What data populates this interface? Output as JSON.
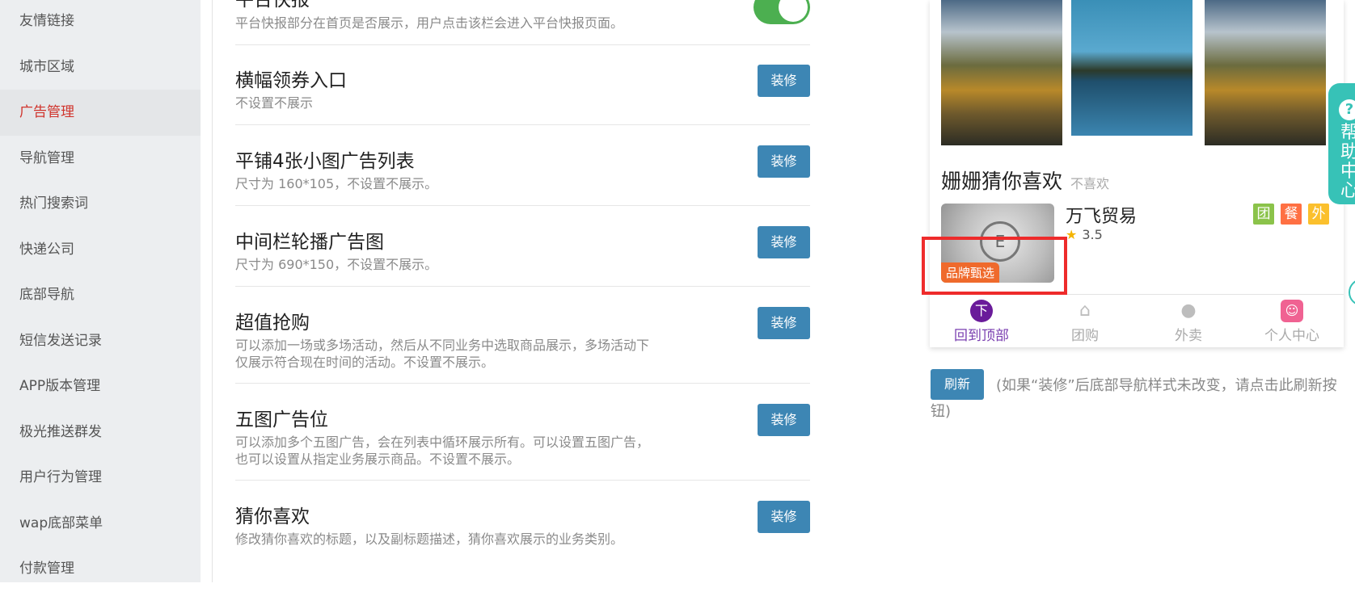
{
  "sidebar": {
    "items": [
      {
        "label": "友情链接",
        "active": false
      },
      {
        "label": "城市区域",
        "active": false
      },
      {
        "label": "广告管理",
        "active": true
      },
      {
        "label": "导航管理",
        "active": false
      },
      {
        "label": "热门搜索词",
        "active": false
      },
      {
        "label": "快递公司",
        "active": false
      },
      {
        "label": "底部导航",
        "active": false
      },
      {
        "label": "短信发送记录",
        "active": false
      },
      {
        "label": "APP版本管理",
        "active": false
      },
      {
        "label": "极光推送群发",
        "active": false
      },
      {
        "label": "用户行为管理",
        "active": false
      },
      {
        "label": "wap底部菜单",
        "active": false
      },
      {
        "label": "付款管理",
        "active": false
      }
    ]
  },
  "settings": {
    "platform_news": {
      "title": "平台快报",
      "desc": "平台快报部分在首页是否展示，用户点击该栏会进入平台快报页面。",
      "toggle_on": true
    },
    "items": [
      {
        "title": "横幅领券入口",
        "desc": "不设置不展示",
        "button": "装修"
      },
      {
        "title": "平铺4张小图广告列表",
        "desc": "尺寸为 160*105，不设置不展示。",
        "button": "装修"
      },
      {
        "title": "中间栏轮播广告图",
        "desc": "尺寸为 690*150，不设置不展示。",
        "button": "装修"
      },
      {
        "title": "超值抢购",
        "desc": "可以添加一场或多场活动，然后从不同业务中选取商品展示，多场活动下仅展示符合现在时间的活动。不设置不展示。",
        "button": "装修"
      },
      {
        "title": "五图广告位",
        "desc": "可以添加多个五图广告，会在列表中循环展示所有。可以设置五图广告，也可以设置从指定业务展示商品。不设置不展示。",
        "button": "装修"
      },
      {
        "title": "猜你喜欢",
        "desc": "修改猜你喜欢的标题，以及副标题描述，猜你喜欢展示的业务类别。",
        "button": "装修"
      }
    ]
  },
  "preview": {
    "guess_title": "姗姗猜你喜欢",
    "guess_subtitle": "不喜欢",
    "shop": {
      "name": "万飞贸易",
      "rating": "3.5",
      "badge": "品牌甄选",
      "tags": [
        {
          "label": "团",
          "color": "#8bc34a"
        },
        {
          "label": "餐",
          "color": "#ff7043"
        },
        {
          "label": "外",
          "color": "#fbc02d"
        }
      ]
    },
    "bottom_nav": [
      {
        "label": "回到顶部",
        "icon": "arrow-top-icon",
        "glyph": "下",
        "active": true,
        "color": "#6a1b9a"
      },
      {
        "label": "团购",
        "icon": "house-icon",
        "glyph": "⌂",
        "active": false,
        "color": "#ffffff"
      },
      {
        "label": "外卖",
        "icon": "location-pin-icon",
        "glyph": "●",
        "active": false,
        "color": "#ffffff"
      },
      {
        "label": "个人中心",
        "icon": "user-face-icon",
        "glyph": "☺",
        "active": false,
        "color": "#f06292"
      }
    ]
  },
  "refresh": {
    "button": "刷新",
    "note": "(如果“装修”后底部导航样式未改变，请点击此刷新按钮)"
  },
  "help": {
    "icon_glyph": "?",
    "text": "帮助中心"
  }
}
